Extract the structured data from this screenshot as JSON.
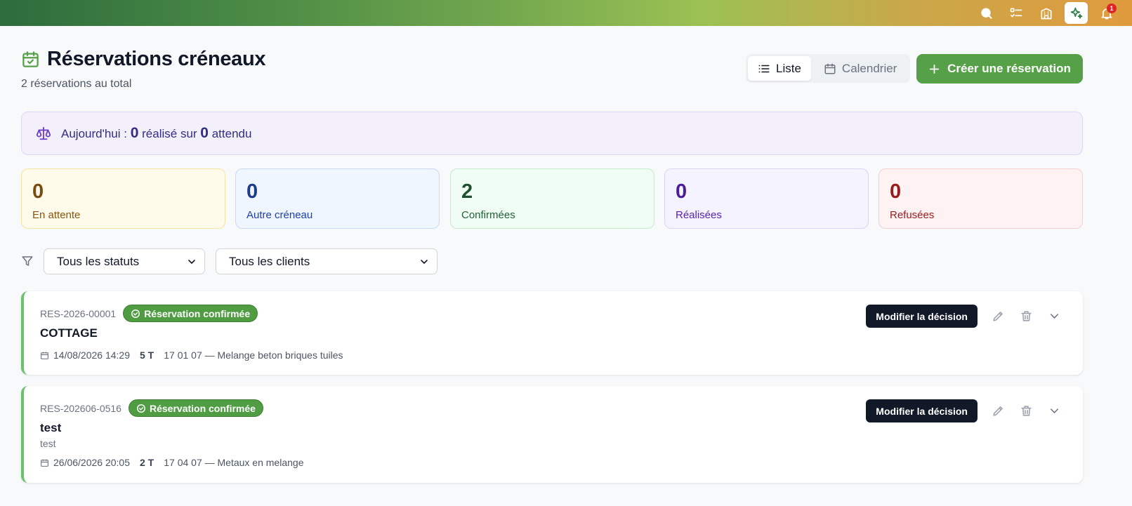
{
  "colors": {
    "accent": "#56a047",
    "stat_pending": "#fffbeb",
    "stat_other": "#eff6ff",
    "stat_confirmed": "#f0fdf4",
    "stat_done": "#f5f3ff",
    "stat_refused": "#fef2f2"
  },
  "topbar": {
    "icons": [
      "search-icon",
      "checklist-icon",
      "building-icon",
      "sparkles-icon",
      "bell-icon"
    ],
    "notification_count": "1"
  },
  "header": {
    "title": "Réservations créneaux",
    "subtitle": "2 réservations au total"
  },
  "view_toggle": {
    "list_label": "Liste",
    "calendar_label": "Calendrier",
    "active": "Liste"
  },
  "create_button": {
    "label": "Créer une réservation"
  },
  "today": {
    "prefix": "Aujourd'hui :",
    "done": "0",
    "middle": "réalisé sur",
    "expected": "0",
    "suffix": "attendu"
  },
  "stats": [
    {
      "value": "0",
      "label": "En attente"
    },
    {
      "value": "0",
      "label": "Autre créneau"
    },
    {
      "value": "2",
      "label": "Confirmées"
    },
    {
      "value": "0",
      "label": "Réalisées"
    },
    {
      "value": "0",
      "label": "Refusées"
    }
  ],
  "filters": {
    "status": "Tous les statuts",
    "client": "Tous les clients"
  },
  "reservations": [
    {
      "ref": "RES-2026-00001",
      "status": "Réservation confirmée",
      "client": "COTTAGE",
      "description": "",
      "date": "14/08/2026 14:29",
      "quantity": "5 T",
      "waste": "17 01 07 — Melange beton briques tuiles",
      "action_label": "Modifier la décision"
    },
    {
      "ref": "RES-202606-0516",
      "status": "Réservation confirmée",
      "client": "test",
      "description": "test",
      "date": "26/06/2026 20:05",
      "quantity": "2 T",
      "waste": "17 04 07 — Metaux en melange",
      "action_label": "Modifier la décision"
    }
  ]
}
